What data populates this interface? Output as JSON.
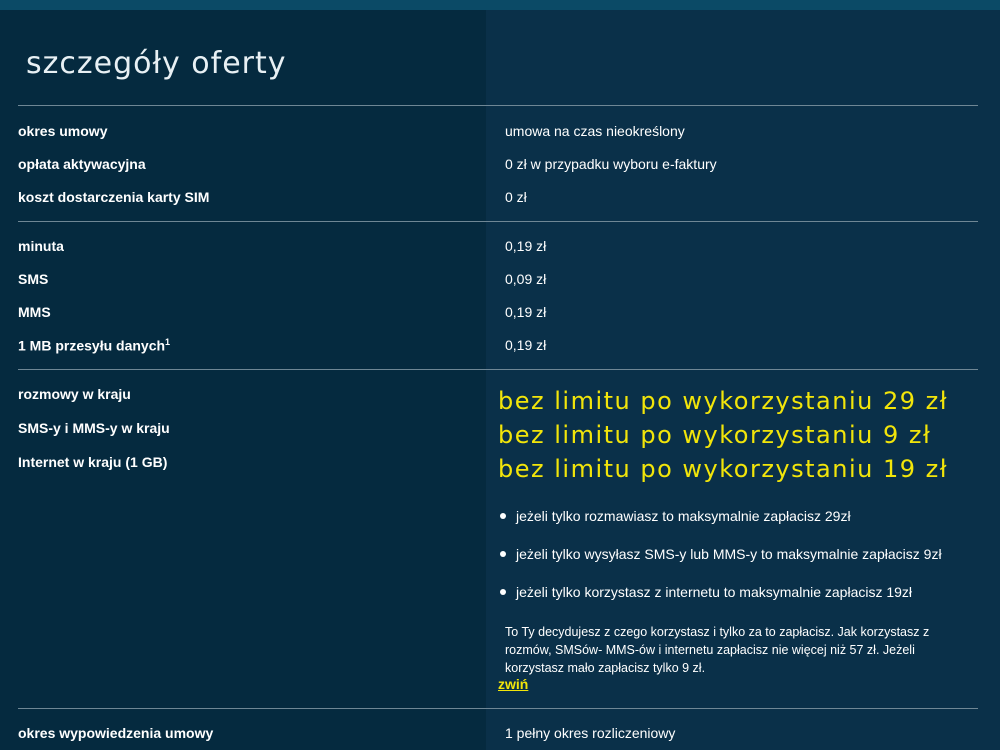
{
  "title": "szczegóły oferty",
  "section1": [
    {
      "label": "okres umowy",
      "value": "umowa na czas nieokreślony"
    },
    {
      "label": "opłata aktywacyjna",
      "value": "0 zł w przypadku wyboru e-faktury"
    },
    {
      "label": "koszt dostarczenia karty SIM",
      "value": "0 zł"
    }
  ],
  "section2": [
    {
      "label": "minuta",
      "value": "0,19 zł"
    },
    {
      "label": "SMS",
      "value": "0,09 zł"
    },
    {
      "label": "MMS",
      "value": "0,19 zł"
    },
    {
      "label": "1 MB przesyłu danych",
      "sup": "1",
      "value": "0,19 zł"
    }
  ],
  "section3": {
    "labels": [
      "rozmowy w kraju",
      "SMS-y i MMS-y w kraju",
      "Internet w kraju (1 GB)"
    ],
    "highlights": [
      "bez limitu po wykorzystaniu 29 zł",
      "bez limitu po wykorzystaniu 9 zł",
      "bez limitu po wykorzystaniu 19 zł"
    ],
    "bullets": [
      "jeżeli tylko rozmawiasz to maksymalnie zapłacisz 29zł",
      "jeżeli tylko wysyłasz SMS-y lub MMS-y to maksymalnie zapłacisz 9zł",
      "jeżeli tylko korzystasz z internetu to maksymalnie zapłacisz 19zł"
    ],
    "paragraph": "To Ty decydujesz z czego korzystasz i tylko za to zapłacisz. Jak korzystasz z rozmów, SMSów- MMS-ów i internetu zapłacisz nie więcej niż 57 zł. Jeżeli korzystasz mało zapłacisz tylko 9 zł.",
    "toggle_label": "zwiń"
  },
  "section4": [
    {
      "label": "okres wypowiedzenia umowy",
      "value": "1 pełny okres rozliczeniowy"
    }
  ],
  "colors": {
    "background": "#052a3f",
    "panel": "#0a3049",
    "accent": "#f2e50a",
    "divider": "#6f8795"
  }
}
